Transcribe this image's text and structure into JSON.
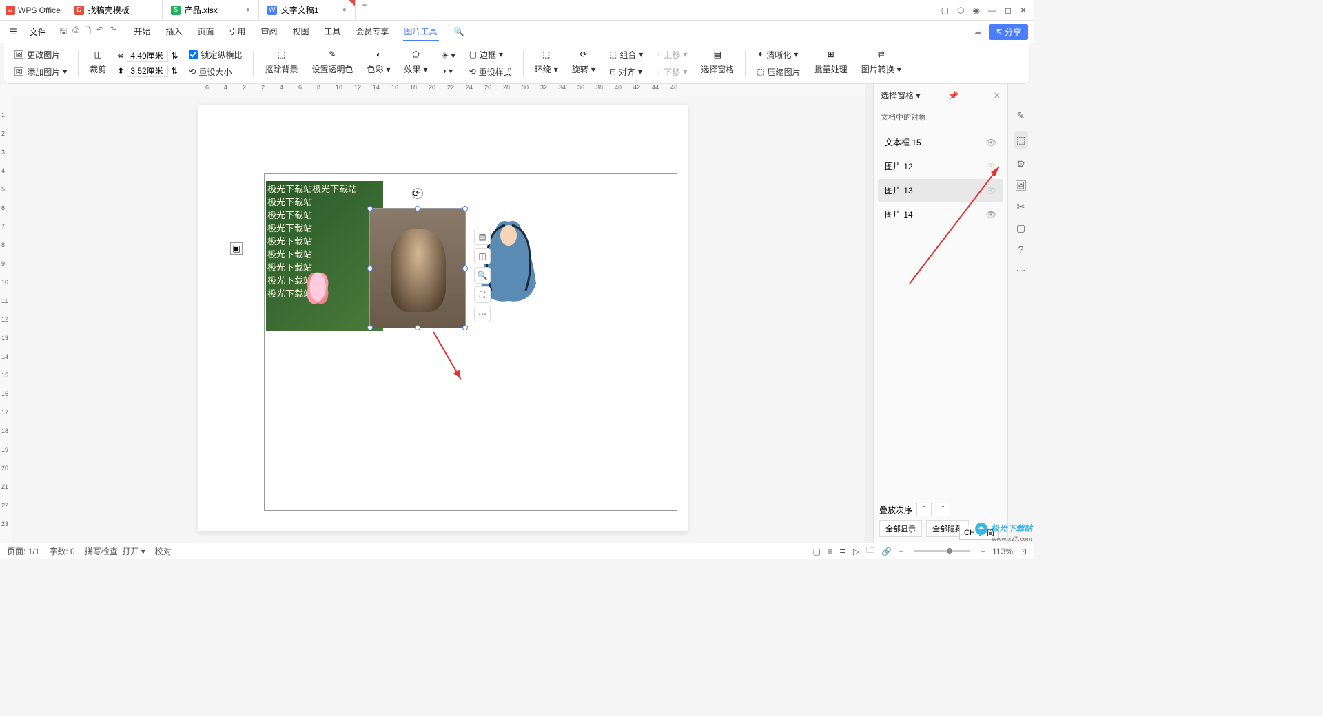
{
  "app": {
    "name": "WPS Office"
  },
  "tabs": [
    {
      "label": "找稿壳模板",
      "icon_bg": "#e74c3c",
      "icon_text": "D"
    },
    {
      "label": "产品.xlsx",
      "icon_bg": "#27ae60",
      "icon_text": "S"
    },
    {
      "label": "文字文稿1",
      "icon_bg": "#4a7dff",
      "icon_text": "W",
      "active": true
    }
  ],
  "file_menu": "文件",
  "menu_tabs": [
    "开始",
    "插入",
    "页面",
    "引用",
    "审阅",
    "视图",
    "工具",
    "会员专享",
    "图片工具"
  ],
  "active_menu_tab": "图片工具",
  "share_label": "分享",
  "ribbon": {
    "change_pic": "更改图片",
    "add_pic": "添加图片",
    "crop": "裁剪",
    "width": "4.49厘米",
    "height": "3.52厘米",
    "lock_ratio": "锁定纵横比",
    "reset_size": "重设大小",
    "remove_bg": "抠除背景",
    "transparency": "设置透明色",
    "color": "色彩",
    "effects": "效果",
    "border": "边框",
    "reset_style": "重设样式",
    "wrap": "环绕",
    "rotate": "旋转",
    "combine": "组合",
    "align": "对齐",
    "move_up": "上移",
    "move_down": "下移",
    "sel_pane": "选择窗格",
    "clarity": "清晰化",
    "compress": "压缩图片",
    "batch": "批量处理",
    "convert": "图片转换"
  },
  "ruler_h": [
    "6",
    "4",
    "2",
    "2",
    "4",
    "6",
    "8",
    "10",
    "12",
    "14",
    "16",
    "18",
    "20",
    "22",
    "24",
    "26",
    "28",
    "30",
    "32",
    "34",
    "36",
    "38",
    "40",
    "42",
    "44",
    "46"
  ],
  "ruler_v": [
    "1",
    "2",
    "3",
    "4",
    "5",
    "6",
    "7",
    "8",
    "9",
    "10",
    "11",
    "12",
    "13",
    "14",
    "15",
    "16",
    "17",
    "18",
    "19",
    "20",
    "21",
    "22",
    "23"
  ],
  "doc_text": "极光下载站",
  "doc_text_first": "极光下载站极光下载站",
  "selection_pane": {
    "title": "选择窗格",
    "subtitle": "文档中的对象",
    "items": [
      {
        "label": "文本框 15",
        "visible": true
      },
      {
        "label": "图片 12",
        "visible": false
      },
      {
        "label": "图片 13",
        "visible": false,
        "selected": true
      },
      {
        "label": "图片 14",
        "visible": true
      }
    ],
    "stack_order": "叠放次序",
    "show_all": "全部显示",
    "hide_all": "全部隐藏"
  },
  "status": {
    "page": "页面: 1/1",
    "words": "字数: 0",
    "spell": "拼写检查: 打开",
    "proof": "校对",
    "zoom": "113%"
  },
  "ime": "CH 小 简",
  "watermark": "极光下载站",
  "watermark_url": "www.xz7.com"
}
